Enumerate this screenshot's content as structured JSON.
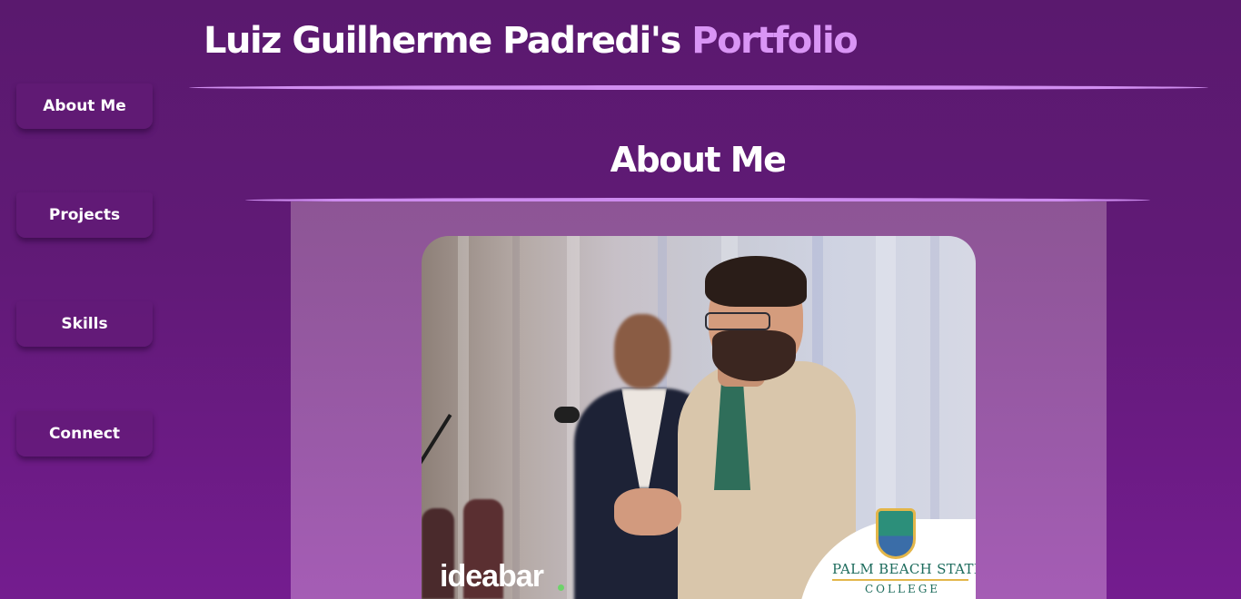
{
  "header": {
    "name": "Luiz Guilherme Padredi's",
    "accent": "Portfolio"
  },
  "nav": {
    "items": [
      {
        "label": "About Me"
      },
      {
        "label": "Projects"
      },
      {
        "label": "Skills"
      },
      {
        "label": "Connect"
      }
    ]
  },
  "section": {
    "title": "About Me"
  },
  "photo": {
    "watermark_left": "ideabar",
    "watermark_right": "PALM BEACH STATE",
    "watermark_right_sub": "COLLEGE"
  },
  "colors": {
    "background": "#611a77",
    "accent": "#d995f5",
    "underline": "#d08ef0",
    "panel": "#9a5aa8"
  }
}
